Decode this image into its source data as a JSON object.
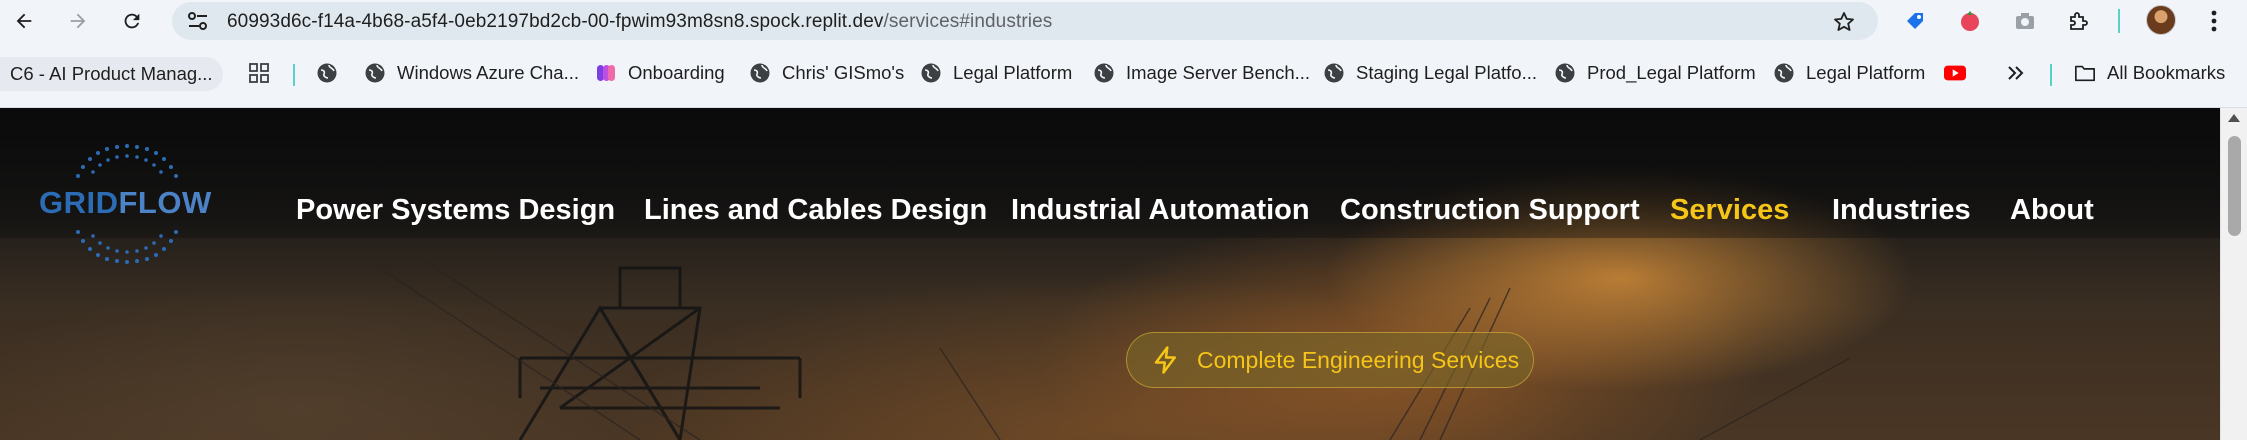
{
  "browser": {
    "url_host": "60993d6c-f14a-4b68-a5f4-0eb2197bd2cb-00-fpwim93m8sn8.spock.replit.dev",
    "url_path": "/services#industries"
  },
  "bookmarks": {
    "items": [
      {
        "label": "C6 - AI Product Manag...",
        "icon": "none"
      },
      {
        "label": "",
        "icon": "apps-grid-icon"
      },
      {
        "label": "",
        "icon": "globe-icon"
      },
      {
        "label": "Windows Azure Cha...",
        "icon": "globe-icon"
      },
      {
        "label": "Onboarding",
        "icon": "onboarding-icon"
      },
      {
        "label": "Chris' GISmo's",
        "icon": "globe-icon"
      },
      {
        "label": "Legal Platform",
        "icon": "globe-icon"
      },
      {
        "label": "Image Server Bench...",
        "icon": "globe-icon"
      },
      {
        "label": "Staging Legal Platfo...",
        "icon": "globe-icon"
      },
      {
        "label": "Prod_Legal Platform",
        "icon": "globe-icon"
      },
      {
        "label": "Legal Platform",
        "icon": "globe-icon"
      },
      {
        "label": "",
        "icon": "youtube-icon"
      }
    ],
    "all_bookmarks": "All Bookmarks"
  },
  "site": {
    "logo": {
      "part1": "GRID",
      "part2": "FLOW"
    },
    "nav": [
      {
        "label": "Power Systems Design",
        "active": false
      },
      {
        "label": "Lines and Cables Design",
        "active": false
      },
      {
        "label": "Industrial Automation",
        "active": false
      },
      {
        "label": "Construction Support",
        "active": false
      },
      {
        "label": "Services",
        "active": true
      },
      {
        "label": "Industries",
        "active": false
      },
      {
        "label": "About",
        "active": false
      }
    ],
    "badge": "Complete Engineering Services",
    "colors": {
      "accent": "#f5c518",
      "logo_blue": "#2c6cb5"
    }
  }
}
